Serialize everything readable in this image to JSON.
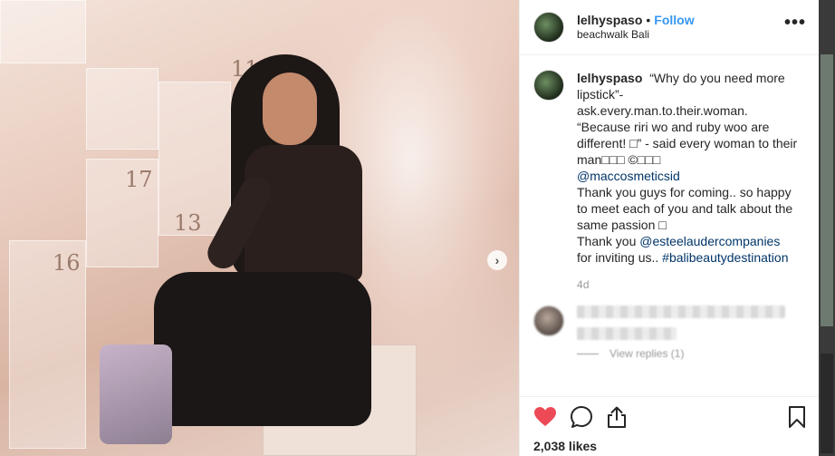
{
  "post": {
    "username": "lelhyspaso",
    "follow_label": "Follow",
    "separator": "•",
    "location": "beachwalk Bali",
    "more_label": "•••"
  },
  "photo": {
    "numbers": [
      "11",
      "17",
      "13",
      "16"
    ],
    "next_arrow": "›"
  },
  "caption": {
    "username": "lelhyspaso",
    "lines": [
      "“Why do you need more lipstick”-",
      "ask.every.man.to.their.woman.",
      "“Because riri wo and ruby woo are different! □” - said every woman to their man□□□ ©□□□"
    ],
    "mention1": "@maccosmeticsid",
    "line_thanks": "Thank you guys for coming.. so happy to meet each of you and talk about the same passion □",
    "line_thanks2_prefix": "Thank you ",
    "mention2": "@esteelaudercompanies",
    "line_thanks2_suffix": "for inviting us.. ",
    "hashtag": "#balibeautydestination",
    "time": "4d"
  },
  "reply": {
    "view_replies": "View replies (1)"
  },
  "actions": {
    "icons": [
      "heart-icon",
      "comment-icon",
      "share-icon",
      "bookmark-icon"
    ],
    "heart_color": "#ed4956",
    "likes": "2,038 likes"
  }
}
